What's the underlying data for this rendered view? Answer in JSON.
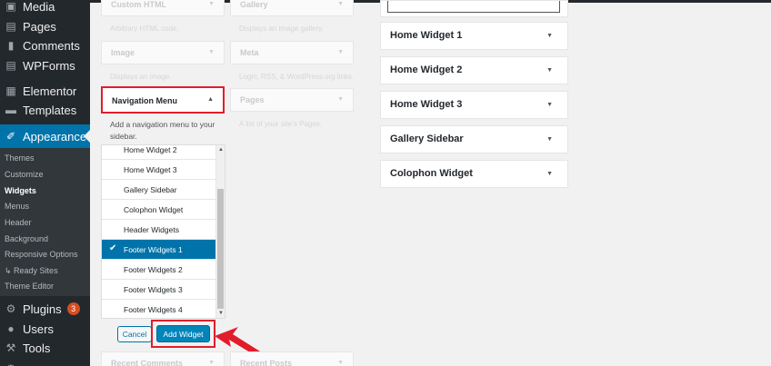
{
  "sidebar": {
    "items": [
      {
        "label": "Media",
        "icon": "media-icon"
      },
      {
        "label": "Pages",
        "icon": "pages-icon"
      },
      {
        "label": "Comments",
        "icon": "comments-icon"
      },
      {
        "label": "WPForms",
        "icon": "wpforms-icon"
      },
      {
        "label": "Elementor",
        "icon": "elementor-icon"
      },
      {
        "label": "Templates",
        "icon": "templates-icon"
      },
      {
        "label": "Appearance",
        "icon": "appearance-icon"
      },
      {
        "label": "Plugins",
        "icon": "plugins-icon",
        "badge": "3"
      },
      {
        "label": "Users",
        "icon": "users-icon"
      },
      {
        "label": "Tools",
        "icon": "tools-icon"
      }
    ],
    "submenu": [
      "Themes",
      "Customize",
      "Widgets",
      "Menus",
      "Header",
      "Background",
      "Responsive Options",
      "↳ Ready Sites",
      "Theme Editor"
    ],
    "accent": "#0073aa"
  },
  "available": {
    "custom_html": {
      "title": "Custom HTML",
      "desc": "Arbitrary HTML code."
    },
    "gallery": {
      "title": "Gallery",
      "desc": "Displays an image gallery."
    },
    "image": {
      "title": "Image",
      "desc": "Displays an image."
    },
    "meta": {
      "title": "Meta",
      "desc": "Login, RSS, & WordPress.org links."
    },
    "nav_menu": {
      "title": "Navigation Menu",
      "desc": "Add a navigation menu to your sidebar."
    },
    "pages": {
      "title": "Pages",
      "desc": "A list of your site’s Pages."
    },
    "recent_comments": {
      "title": "Recent Comments"
    },
    "recent_posts": {
      "title": "Recent Posts"
    }
  },
  "chooser": {
    "options": [
      "Home Widget 2",
      "Home Widget 3",
      "Gallery Sidebar",
      "Colophon Widget",
      "Header Widgets",
      "Footer Widgets 1",
      "Footer Widgets 2",
      "Footer Widgets 3",
      "Footer Widgets 4"
    ],
    "selected": "Footer Widgets 1",
    "cancel_label": "Cancel",
    "add_label": "Add Widget"
  },
  "sidebars": [
    "Home Widget 1",
    "Home Widget 2",
    "Home Widget 3",
    "Gallery Sidebar",
    "Colophon Widget"
  ],
  "annotation_color": "#e11d2c"
}
